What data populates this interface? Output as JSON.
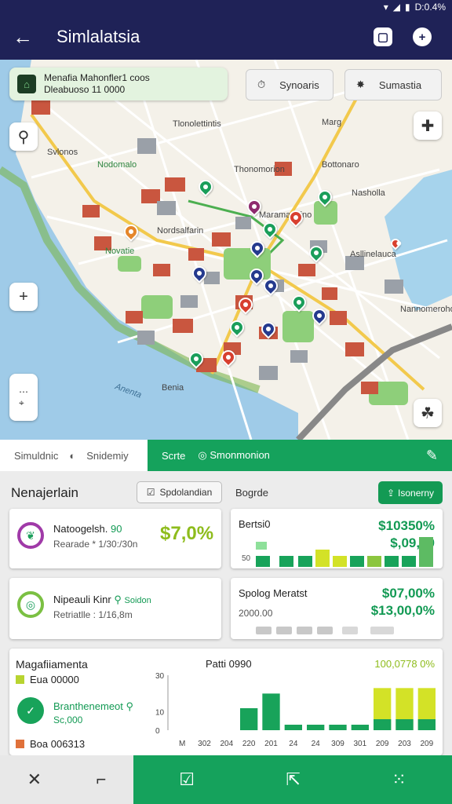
{
  "status": {
    "time": "D:0.4%",
    "icons": [
      "wifi-icon",
      "signal-icon",
      "battery-icon"
    ]
  },
  "appbar": {
    "title": "Simlalatsia",
    "actions": [
      "square-icon",
      "plus-circle-icon"
    ]
  },
  "map": {
    "location_card": {
      "title": "Menafia Mahonfler1 coos",
      "subtitle": "Dleabuoso 11 0000"
    },
    "buttons": {
      "synoaris": "Synoaris",
      "sumastia": "Sumastia"
    },
    "labels": {
      "l1": "Tlonolettintis",
      "l2": "Marg",
      "l3": "Nodomalo",
      "l4": "Svlonos",
      "l5": "Thonomorion",
      "l6": "Bottonaro",
      "l7": "Nasholla",
      "l8": "Nordsalfarin",
      "l9": "Maramanaino",
      "l10": "Asllinelauca",
      "l11": "Nannomeroho",
      "l12": "Benia",
      "l13": "Anenta",
      "l14": "Novatie"
    }
  },
  "tabs": {
    "t1": "Simuldnic",
    "t2": "Snidemiy",
    "t3": "Scrte",
    "t4": "Smonmonion"
  },
  "panel": {
    "title": "Nenajerlain",
    "chip": "Spdolandian",
    "section": "Bogrde",
    "action": "Isonerny",
    "card1": {
      "title": "Natoogelsh.",
      "title_value": "90",
      "sub": "Rearade * 1/30:/30n",
      "big": "$7,0%"
    },
    "card2": {
      "title": "Bertsi",
      "title_value": "0",
      "big1": "$10350%",
      "big2": "$,09,80",
      "axis": "50"
    },
    "card3": {
      "title": "Nipeauli Kinr",
      "tag": "Soidon",
      "sub": "Retriatlle : 1/16,8m"
    },
    "card4": {
      "title": "Spolog Meratst",
      "axis": "2000.00",
      "big1": "$07,00%",
      "big2": "$13,00,0%"
    },
    "card5": {
      "title": "Magafiiamenta",
      "row1": "Eua 00000",
      "row2_title": "Branthenemeot",
      "row2_sub": "Sc,000",
      "row3": "Boa 006313",
      "chart_title": "Patti 0990",
      "chart_right": "100,0778 0%"
    }
  },
  "chart_data": {
    "type": "bar",
    "categories": [
      "M",
      "302",
      "204",
      "220",
      "201",
      "24",
      "24",
      "309",
      "301",
      "209",
      "203",
      "209"
    ],
    "values": [
      0,
      0,
      0,
      12,
      20,
      3,
      3,
      3,
      3,
      23,
      23,
      23
    ],
    "yticks": [
      "30",
      "10",
      "0"
    ],
    "ylim": [
      0,
      30
    ]
  },
  "bottomnav": {
    "items": [
      "close-icon",
      "crop-icon",
      "calendar-check-icon",
      "share-icon",
      "grid-icon"
    ]
  }
}
